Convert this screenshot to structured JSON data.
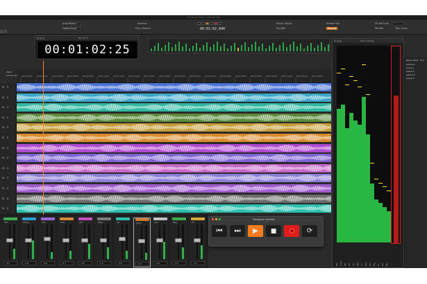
{
  "window": {
    "title": "Pro Tools Session - Edit Window"
  },
  "toolbar": {
    "auto_return": "Auto Return",
    "follow_range": "Follow Range",
    "internal": "Internal",
    "sync_source": "Sync Source",
    "timecode": "00:01:02.840",
    "punch_in_out": "Punch In/Out",
    "pre_roll": "Pre-Roll",
    "stereo_out": "Stereo Out",
    "record_mode": "Record",
    "export_format": "24 bit FLAC",
    "sample_rate": "96 kHz",
    "rec_level": "Rec Level"
  },
  "big_clock": {
    "title": "Big Clock",
    "time": "00:01:02:25"
  },
  "ruler": {
    "row_labels": [
      "+Bars",
      "+Timecode"
    ],
    "ticks": [
      "00:01:00:00",
      "00:01:02:00",
      "00:01:04:00",
      "00:01:06:00",
      "00:01:08:00",
      "00:01:10:00",
      "00:01:12:00",
      "00:01:14:00",
      "00:01:16:00",
      "00:01:18:00",
      "00:01:20:00",
      "00:01:22:00",
      "00:01:24:00",
      "00:01:26:00",
      "00:01:28:00",
      "00:01:30:00",
      "00:01:32:00",
      "00:01:34:00",
      "00:01:36:00",
      "00:01:38:00"
    ]
  },
  "tracks": [
    {
      "color": "#4a73d6",
      "m": "M",
      "s": "S"
    },
    {
      "color": "#3aa7c9",
      "m": "M",
      "s": "S"
    },
    {
      "color": "#2fb7a2",
      "m": "M",
      "s": "S"
    },
    {
      "color": "#5a8a3a",
      "m": "M",
      "s": "S"
    },
    {
      "color": "#c39a35",
      "m": "M",
      "s": "S"
    },
    {
      "color": "#d98a2b",
      "m": "M",
      "s": "S"
    },
    {
      "color": "#b04bd1",
      "m": "M",
      "s": "S"
    },
    {
      "color": "#7f62d4",
      "m": "M",
      "s": "S"
    },
    {
      "color": "#c567c9",
      "m": "M",
      "s": "S"
    },
    {
      "color": "#8d7fd8",
      "m": "M",
      "s": "S"
    },
    {
      "color": "#a05ccf",
      "m": "M",
      "s": "S"
    },
    {
      "color": "#6c6c6c",
      "m": "M",
      "s": "S"
    },
    {
      "color": "#2cbfae",
      "m": "M",
      "s": "S"
    }
  ],
  "mixer": {
    "strips": [
      {
        "name": "Kick",
        "color": "#3fae4f",
        "fader": 0.55,
        "meter": 0.3,
        "value": "-3.5"
      },
      {
        "name": "Snare",
        "color": "#2f9fd3",
        "fader": 0.55,
        "meter": 0.55,
        "value": "-1.9"
      },
      {
        "name": "Hat",
        "color": "#9a6ad8",
        "fader": 0.6,
        "meter": 0.2,
        "value": "-4.0"
      },
      {
        "name": "Tom",
        "color": "#d8863a",
        "fader": 0.55,
        "meter": 0.25,
        "value": "-2.7"
      },
      {
        "name": "OH",
        "color": "#c74fc1",
        "fader": 0.55,
        "meter": 0.45,
        "value": "-3.2"
      },
      {
        "name": "Bass",
        "color": "#7c7c7c",
        "fader": 0.55,
        "meter": 0.35,
        "value": "-1.2"
      },
      {
        "name": "Gtr",
        "color": "#2cbfae",
        "fader": 0.6,
        "meter": 0.25,
        "value": "-5.0"
      },
      {
        "name": "Keys",
        "color": "#d27a2e",
        "fader": 0.55,
        "meter": 0.2,
        "value": "-2.3"
      },
      {
        "name": "Vox",
        "color": "#c2c2c2",
        "fader": 0.55,
        "meter": 0.5,
        "value": "-0.8"
      },
      {
        "name": "Bkg",
        "color": "#3fae4f",
        "fader": 0.55,
        "meter": 0.35,
        "value": "-3.9"
      },
      {
        "name": "FX",
        "color": "#d8a83a",
        "fader": 0.55,
        "meter": 0.4,
        "value": "-2.1"
      }
    ]
  },
  "transport": {
    "title": "Transport Controls",
    "rewind_glyph": "⏮",
    "forward_glyph": "⏭",
    "play_glyph": "▶",
    "stop_glyph": "■",
    "loop_glyph": "⟳"
  },
  "meter_bridge": {
    "title": "Meter Bridge",
    "levels": [
      0.68,
      0.7,
      0.58,
      0.66,
      0.62,
      0.6,
      0.74,
      0.55,
      0.3,
      0.22,
      0.2,
      0.18,
      0.16
    ],
    "peaks": [
      0.86,
      0.88,
      0.8,
      0.84,
      0.82,
      0.79,
      0.9,
      0.75,
      0.4,
      0.32,
      0.3,
      0.28,
      0.26
    ],
    "channel_labels": [
      "Kick",
      "Snare",
      "Hat",
      "Tom",
      "OH",
      "Bass",
      "Gtr",
      "Keys",
      "Vox",
      "Bkg",
      "FX",
      "Bus",
      "Mst"
    ]
  },
  "right_panel": {
    "header": [
      "Name",
      "Start",
      "End"
    ],
    "rows": [
      "section1",
      "scene 1",
      "scene 2",
      "section2",
      "scene 3"
    ]
  },
  "colors": {
    "accent_orange": "#ff7a1a",
    "record_red": "#e21b1b",
    "meter_green": "#29b643"
  }
}
